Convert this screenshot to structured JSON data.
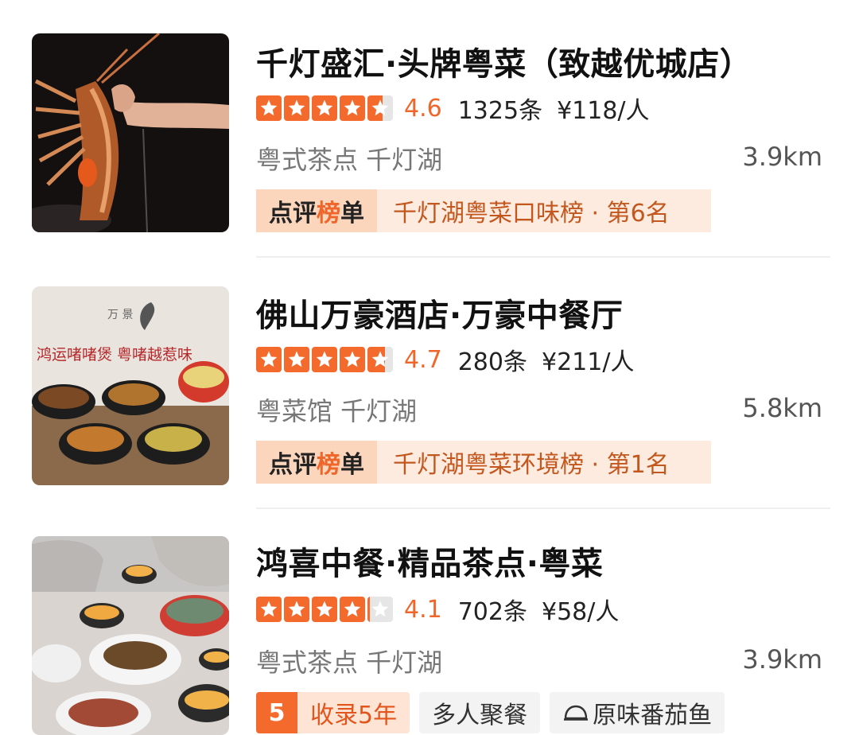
{
  "restaurants": [
    {
      "name": "千灯盛汇·头牌粤菜（致越优城店）",
      "rating": 4.6,
      "score_text": "4.6",
      "reviews": "1325条",
      "price": "¥118/人",
      "category": "粤式茶点 千灯湖",
      "distance": "3.9km",
      "rank_label": "点评榜单",
      "rank_text": "千灯湖粤菜口味榜 · 第6名"
    },
    {
      "name": "佛山万豪酒店·万豪中餐厅",
      "rating": 4.7,
      "score_text": "4.7",
      "reviews": "280条",
      "price": "¥211/人",
      "category": "粤菜馆 千灯湖",
      "distance": "5.8km",
      "rank_label": "点评榜单",
      "rank_text": "千灯湖粤菜环境榜 · 第1名",
      "image_text": "鸿运啫啫煲 粤啫越惹味",
      "image_logo": "万 景"
    },
    {
      "name": "鸿喜中餐·精品茶点·粤菜",
      "rating": 4.1,
      "score_text": "4.1",
      "reviews": "702条",
      "price": "¥58/人",
      "category": "粤式茶点 千灯湖",
      "distance": "3.9km",
      "tags": {
        "years_num": "5",
        "years_text": "收录5年",
        "group": "多人聚餐",
        "dish": "原味番茄鱼"
      }
    }
  ],
  "colors": {
    "accent": "#f36a2c",
    "rank_head_bg": "#fbd6bd",
    "rank_body_bg": "#fdebe0",
    "star_empty": "#e6e6e6"
  }
}
